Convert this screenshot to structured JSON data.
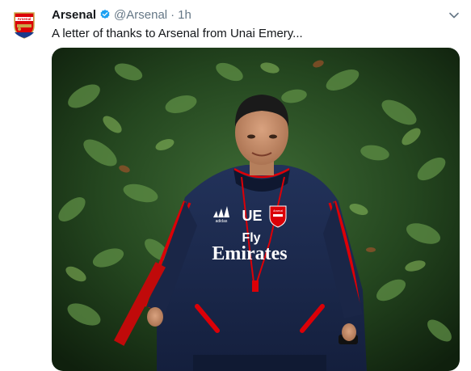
{
  "tweet": {
    "display_name": "Arsenal",
    "handle": "@Arsenal",
    "separator": "·",
    "time": "1h",
    "text": "A letter of thanks to Arsenal from Unai Emery...",
    "avatar_label": "Arsenal"
  },
  "photo": {
    "crest_text": "Arsenal",
    "jacket_initials": "UE",
    "sponsor_line1": "Fly",
    "sponsor_line2": "Emirates",
    "maker_text": "adidas"
  },
  "colors": {
    "text_primary": "#14171a",
    "text_secondary": "#657786",
    "verified_blue": "#1da1f2",
    "arsenal_red": "#db0007",
    "navy": "#1b2847"
  }
}
